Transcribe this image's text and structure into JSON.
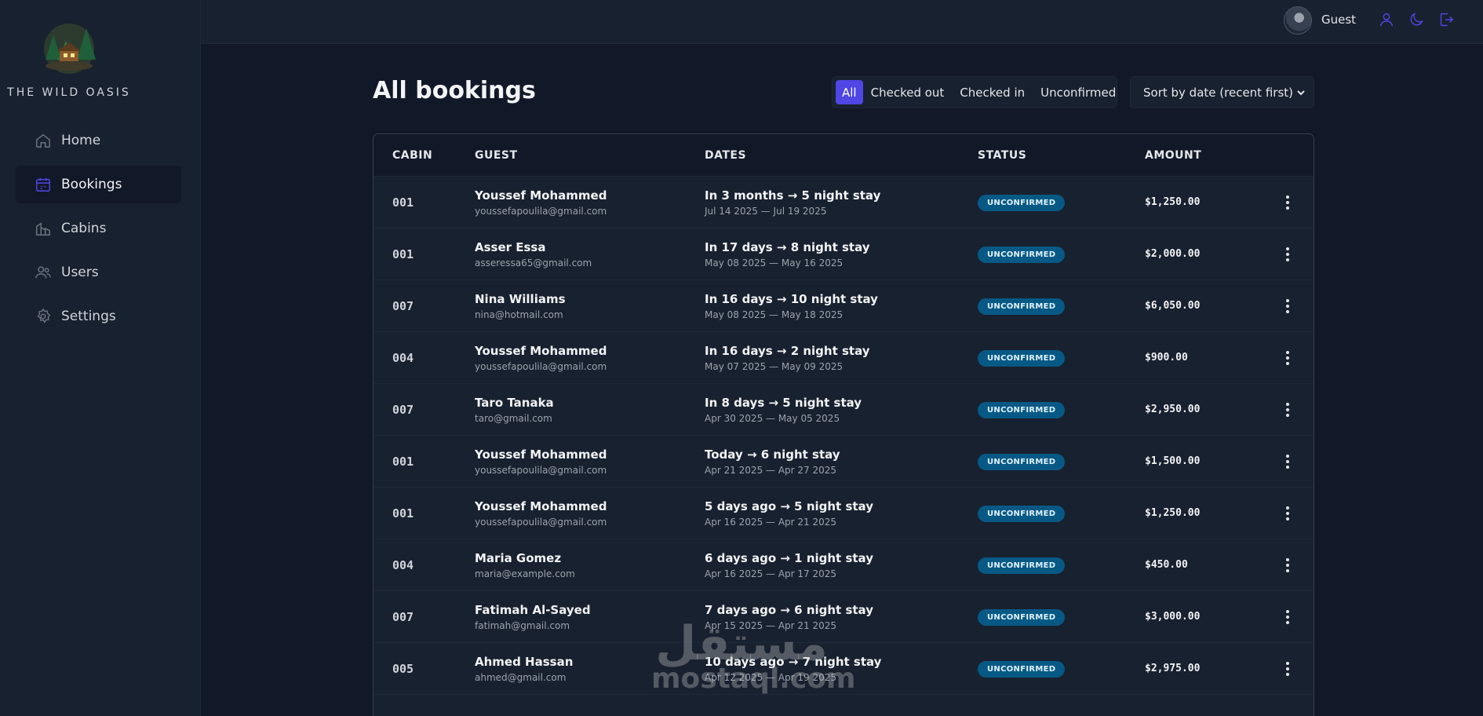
{
  "app": {
    "name": "THE WILD OASIS",
    "accent": "#4f46e5"
  },
  "sidebar": {
    "items": [
      {
        "label": "Home",
        "icon": "home-icon"
      },
      {
        "label": "Bookings",
        "icon": "calendar-icon",
        "active": true
      },
      {
        "label": "Cabins",
        "icon": "cabins-icon"
      },
      {
        "label": "Users",
        "icon": "users-icon"
      },
      {
        "label": "Settings",
        "icon": "gear-icon"
      }
    ]
  },
  "header": {
    "user_name": "Guest",
    "icons": [
      "user-icon",
      "moon-icon",
      "logout-icon"
    ]
  },
  "page": {
    "title": "All bookings"
  },
  "filter": {
    "options": [
      "All",
      "Checked out",
      "Checked in",
      "Unconfirmed"
    ],
    "active": "All"
  },
  "sort": {
    "selected": "Sort by date (recent first)"
  },
  "table": {
    "headers": [
      "CABIN",
      "GUEST",
      "DATES",
      "STATUS",
      "AMOUNT"
    ],
    "rows": [
      {
        "cabin": "001",
        "guest": "Youssef Mohammed",
        "email": "youssefapoulila@gmail.com",
        "dates": "In 3 months → 5 night stay",
        "range": "Jul 14 2025 — Jul 19 2025",
        "status": "UNCONFIRMED",
        "amount": "$1,250.00"
      },
      {
        "cabin": "001",
        "guest": "Asser Essa",
        "email": "asseressa65@gmail.com",
        "dates": "In 17 days → 8 night stay",
        "range": "May 08 2025 — May 16 2025",
        "status": "UNCONFIRMED",
        "amount": "$2,000.00"
      },
      {
        "cabin": "007",
        "guest": "Nina Williams",
        "email": "nina@hotmail.com",
        "dates": "In 16 days → 10 night stay",
        "range": "May 08 2025 — May 18 2025",
        "status": "UNCONFIRMED",
        "amount": "$6,050.00"
      },
      {
        "cabin": "004",
        "guest": "Youssef Mohammed",
        "email": "youssefapoulila@gmail.com",
        "dates": "In 16 days → 2 night stay",
        "range": "May 07 2025 — May 09 2025",
        "status": "UNCONFIRMED",
        "amount": "$900.00"
      },
      {
        "cabin": "007",
        "guest": "Taro Tanaka",
        "email": "taro@gmail.com",
        "dates": "In 8 days → 5 night stay",
        "range": "Apr 30 2025 — May 05 2025",
        "status": "UNCONFIRMED",
        "amount": "$2,950.00"
      },
      {
        "cabin": "001",
        "guest": "Youssef Mohammed",
        "email": "youssefapoulila@gmail.com",
        "dates": "Today → 6 night stay",
        "range": "Apr 21 2025 — Apr 27 2025",
        "status": "UNCONFIRMED",
        "amount": "$1,500.00"
      },
      {
        "cabin": "001",
        "guest": "Youssef Mohammed",
        "email": "youssefapoulila@gmail.com",
        "dates": "5 days ago → 5 night stay",
        "range": "Apr 16 2025 — Apr 21 2025",
        "status": "UNCONFIRMED",
        "amount": "$1,250.00"
      },
      {
        "cabin": "004",
        "guest": "Maria Gomez",
        "email": "maria@example.com",
        "dates": "6 days ago → 1 night stay",
        "range": "Apr 16 2025 — Apr 17 2025",
        "status": "UNCONFIRMED",
        "amount": "$450.00"
      },
      {
        "cabin": "007",
        "guest": "Fatimah Al-Sayed",
        "email": "fatimah@gmail.com",
        "dates": "7 days ago → 6 night stay",
        "range": "Apr 15 2025 — Apr 21 2025",
        "status": "UNCONFIRMED",
        "amount": "$3,000.00"
      },
      {
        "cabin": "005",
        "guest": "Ahmed Hassan",
        "email": "ahmed@gmail.com",
        "dates": "10 days ago → 7 night stay",
        "range": "Apr 12 2025 — Apr 19 2025",
        "status": "UNCONFIRMED",
        "amount": "$2,975.00"
      }
    ]
  },
  "watermark": {
    "arabic": "مستقل",
    "latin": "mostaql.com"
  }
}
